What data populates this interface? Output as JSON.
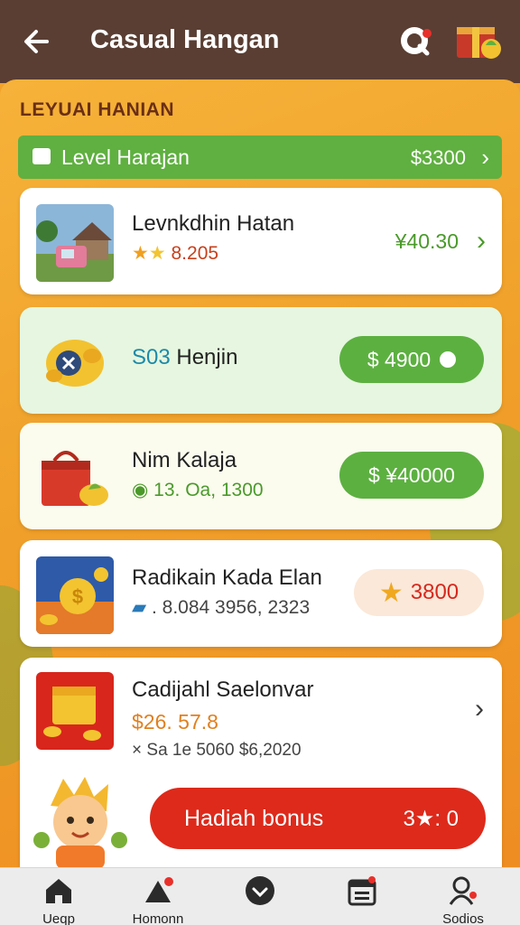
{
  "header": {
    "title": "Casual Hangan",
    "back_icon": "arrow-left-icon",
    "search_icon": "search-icon",
    "gift_icon": "gift-box-icon"
  },
  "section": {
    "label": "LEYUAI HANIAN"
  },
  "level_bar": {
    "label": "Level Harajan",
    "value": "$3300"
  },
  "items": [
    {
      "title": "Levnkdhin Hatan",
      "rating": "8.205",
      "price": "¥40.30"
    },
    {
      "title_prefix": "S03",
      "title": "Henjin",
      "button": "$ 4900"
    },
    {
      "title": "Nim Kalaja",
      "sub": "13. Oa, 1300",
      "button": "$ ¥40000"
    },
    {
      "title": "Radikain Kada Elan",
      "sub": ". 8.084 3956, 2323",
      "badge": "3800"
    },
    {
      "title": "Cadijahl Saelonvar",
      "price": "$26. 57.8",
      "sub": "Sa 1e 5060 $6,2020"
    }
  ],
  "bonus_button": {
    "label": "Hadiah bonus",
    "right": "3★: 0"
  },
  "nav": [
    {
      "label": "Ueqp",
      "icon": "home-icon"
    },
    {
      "label": "Homonn",
      "icon": "play-shop-icon"
    },
    {
      "label": "",
      "icon": "chevron-circle-icon"
    },
    {
      "label": "",
      "icon": "calendar-icon"
    },
    {
      "label": "Sodios",
      "icon": "profile-icon"
    }
  ],
  "colors": {
    "header": "#5a3e33",
    "accent_green": "#5cb040",
    "accent_red": "#dd2a1b",
    "background": "#f3a32a"
  }
}
